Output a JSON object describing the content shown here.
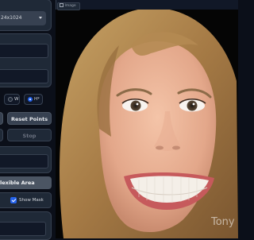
{
  "left_panel": {
    "select_value": "24x1024",
    "radio_w_label": "W",
    "radio_hw_label": "H*",
    "reset_label": "Reset Points",
    "stop_label": "Stop",
    "flexible_label": "lexible Area",
    "show_mask_label": "Show Mask"
  },
  "image_panel": {
    "tab_label": "Image",
    "watermark": "Tony"
  },
  "colors": {
    "background": "#0b0f19",
    "panel": "#1f2937",
    "accent": "#2563eb"
  }
}
